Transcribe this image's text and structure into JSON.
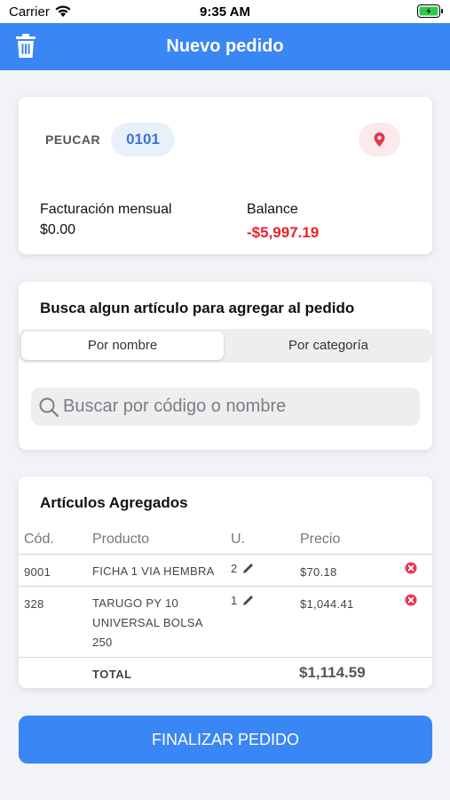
{
  "status_bar": {
    "carrier": "Carrier",
    "time": "9:35 AM"
  },
  "nav": {
    "title": "Nuevo pedido",
    "trash_icon": "trash-icon",
    "color": "#3a86f5"
  },
  "client": {
    "code": "PEUCAR",
    "number": "0101",
    "location_icon": "location-pin-icon",
    "billing_label": "Facturación mensual",
    "billing_value": "$0.00",
    "balance_label": "Balance",
    "balance_value": "-$5,997.19",
    "balance_color": "#e8222a"
  },
  "search": {
    "title": "Busca algun artículo para agregar al pedido",
    "segments": [
      "Por nombre",
      "Por categoría"
    ],
    "selected_segment": "Por nombre",
    "placeholder": "Buscar por código o nombre"
  },
  "items": {
    "title": "Artículos Agregados",
    "columns": [
      "Cód.",
      "Producto",
      "U.",
      "Precio"
    ],
    "rows": [
      {
        "code": "9001",
        "product": "FICHA 1 VIA HEMBRA",
        "qty": "2",
        "price": "$70.18"
      },
      {
        "code": "328",
        "product": "TARUGO PY 10 UNIVERSAL BOLSA 250",
        "qty": "1",
        "price": "$1,044.41"
      }
    ],
    "total_label": "TOTAL",
    "total_value": "$1,114.59"
  },
  "finish_button": "FINALIZAR PEDIDO"
}
